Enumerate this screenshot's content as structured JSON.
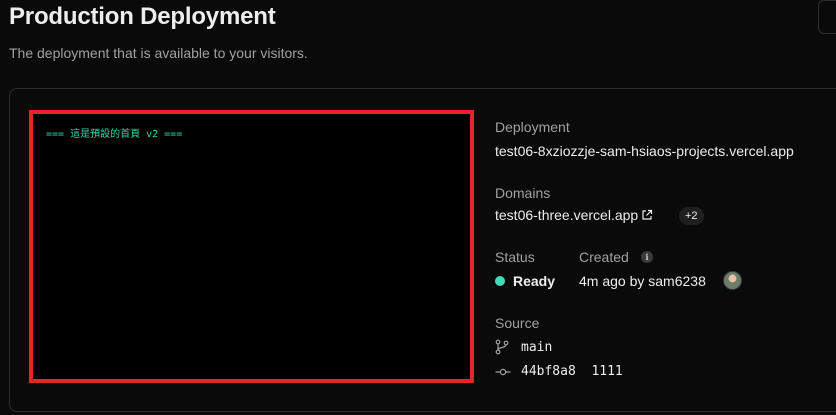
{
  "header": {
    "title": "Production Deployment",
    "subtitle": "The deployment that is available to your visitors."
  },
  "preview": {
    "text": "=== 這是預設的首頁 v2 ==="
  },
  "details": {
    "deployment_label": "Deployment",
    "deployment_value": "test06-8xziozzje-sam-hsiaos-projects.vercel.app",
    "domains_label": "Domains",
    "domains_value": "test06-three.vercel.app",
    "domains_more": "+2",
    "status_label": "Status",
    "status_value": "Ready",
    "status_color": "#44d9b4",
    "created_label": "Created",
    "created_value": "4m ago by sam6238",
    "source_label": "Source",
    "branch": "main",
    "commit": "44bf8a8  1111"
  },
  "accent": {
    "highlight_border": "#e8232b"
  },
  "icons": {
    "external_link": "external-link-icon",
    "info": "info-icon",
    "branch": "git-branch-icon",
    "commit": "git-commit-icon"
  }
}
